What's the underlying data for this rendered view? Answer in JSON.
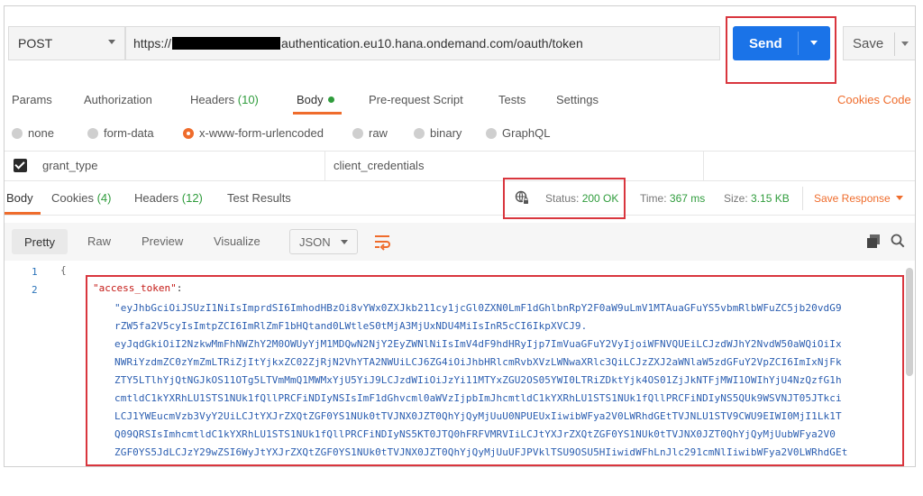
{
  "request": {
    "method": "POST",
    "url_prefix": "https://",
    "url_suffix": "authentication.eu10.hana.ondemand.com/oauth/token",
    "send_label": "Send",
    "save_label": "Save"
  },
  "request_tabs": {
    "params": "Params",
    "authorization": "Authorization",
    "headers": "Headers",
    "headers_count": "(10)",
    "body": "Body",
    "pre_request": "Pre-request Script",
    "tests": "Tests",
    "settings": "Settings",
    "cookies": "Cookies",
    "code": "Code"
  },
  "body_types": [
    "none",
    "form-data",
    "x-www-form-urlencoded",
    "raw",
    "binary",
    "GraphQL"
  ],
  "selected_body_type": "x-www-form-urlencoded",
  "form_row": {
    "key": "grant_type",
    "value": "client_credentials"
  },
  "response_tabs": {
    "body": "Body",
    "cookies": "Cookies",
    "cookies_count": "(4)",
    "headers": "Headers",
    "headers_count": "(12)",
    "test_results": "Test Results"
  },
  "response_meta": {
    "status_label": "Status:",
    "status_value": "200 OK",
    "time_label": "Time:",
    "time_value": "367 ms",
    "size_label": "Size:",
    "size_value": "3.15 KB",
    "save_response": "Save Response"
  },
  "viewer": {
    "pretty": "Pretty",
    "raw": "Raw",
    "preview": "Preview",
    "visualize": "Visualize",
    "format": "JSON"
  },
  "code": {
    "line1": "1",
    "line2": "2",
    "fold": "{",
    "key": "\"access_token\"",
    "colon": ":",
    "token_lines": [
      "\"eyJhbGciOiJSUzI1NiIsImprdSI6ImhodHBzOi8vYWx0ZXJkb211cy1jcGl0ZXN0LmF1dGhlbnRpY2F0aW9uLmV1MTAuaGFuYS5vbmRlbWFuZC5jb20vdG9",
      "rZW5fa2V5cyIsImtpZCI6ImRlZmF1bHQtand0LWtleS0tMjA3MjUxNDU4MiIsInR5cCI6IkpXVCJ9.",
      "eyJqdGkiOiI2NzkwMmFhNWZhY2M0OWUyYjM1MDQwN2NjY2EyZWNlNiIsImV4dF9hdHRyIjp7ImVuaGFuY2VyIjoiWFNVQUEiLCJzdWJhY2NvdW50aWQiOiIx",
      "NWRiYzdmZC0zYmZmLTRiZjItYjkxZC02ZjRjN2VhYTA2NWUiLCJ6ZG4iOiJhbHRlcmRvbXVzLWNwaXRlc3QiLCJzZXJ2aWNlaW5zdGFuY2VpZCI6ImIxNjFk",
      "ZTY5LTlhYjQtNGJkOS11OTg5LTVmMmQ1MWMxYjU5YiJ9LCJzdWIiOiJzYi11MTYxZGU2OS05YWI0LTRiZDktYjk4OS01ZjJkNTFjMWI1OWIhYjU4NzQzfG1h",
      "cmtldC1kYXRhLU1STS1NUk1fQllPRCFiNDIyNSIsImF1dGhvcml0aWVzIjpbImJhcmtldC1kYXRhLU1STS1NUk1fQllPRCFiNDIyNS5QUk9WSVNJT05JTkci",
      "LCJ1YWEucmVzb3VyY2UiLCJtYXJrZXQtZGF0YS1NUk0tTVJNX0JZT0QhYjQyMjUuU0NPUEUxIiwibWFya2V0LWRhdGEtTVJNLU1STV9CWU9EIWI0MjI1Lk1T",
      "Q09QRSIsImhcmtldC1kYXRhLU1STS1NUk1fQllPRCFiNDIyNS5KT0JTQ0hFRFVMRVIiLCJtYXJrZXQtZGF0YS1NUk0tTVJNX0JZT0QhYjQyMjUubWFya2V0",
      "ZGF0YS5JdLCJzY29wZSI6WyJtYXJrZXQtZGF0YS1NUk0tTVJNX0JZT0QhYjQyMjUuUFJPVklTSU9OSU5HIiwidWFhLnJlc291cmNlIiwibWFya2V0LWRhdGEt"
    ]
  },
  "colors": {
    "accent": "#ef6c2c",
    "send_blue": "#1a73e8",
    "status_green": "#2f9c3c",
    "highlight_red": "#d9363e",
    "token_blue": "#2a5db0",
    "key_red": "#c41a16"
  },
  "icons": [
    "caret-down-icon",
    "globe-icon",
    "wrap-lines-icon",
    "copy-icon",
    "search-icon",
    "checkbox-icon"
  ]
}
